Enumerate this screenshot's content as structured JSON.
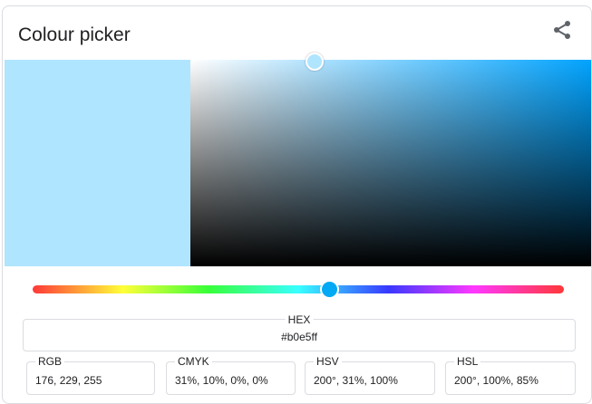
{
  "title": "Colour picker",
  "share_icon": "share-icon",
  "color": {
    "hex_value": "#b0e5ff",
    "hue_color": "#00a3ff",
    "handle_color": "#03a9f4",
    "saturation_fraction": 0.31,
    "value_fraction": 1.0,
    "hue_fraction": 0.556
  },
  "fields": {
    "hex": {
      "label": "HEX",
      "value": "#b0e5ff"
    },
    "rgb": {
      "label": "RGB",
      "value": "176, 229, 255"
    },
    "cmyk": {
      "label": "CMYK",
      "value": "31%, 10%, 0%, 0%"
    },
    "hsv": {
      "label": "HSV",
      "value": "200°, 31%, 100%"
    },
    "hsl": {
      "label": "HSL",
      "value": "200°, 100%, 85%"
    }
  }
}
